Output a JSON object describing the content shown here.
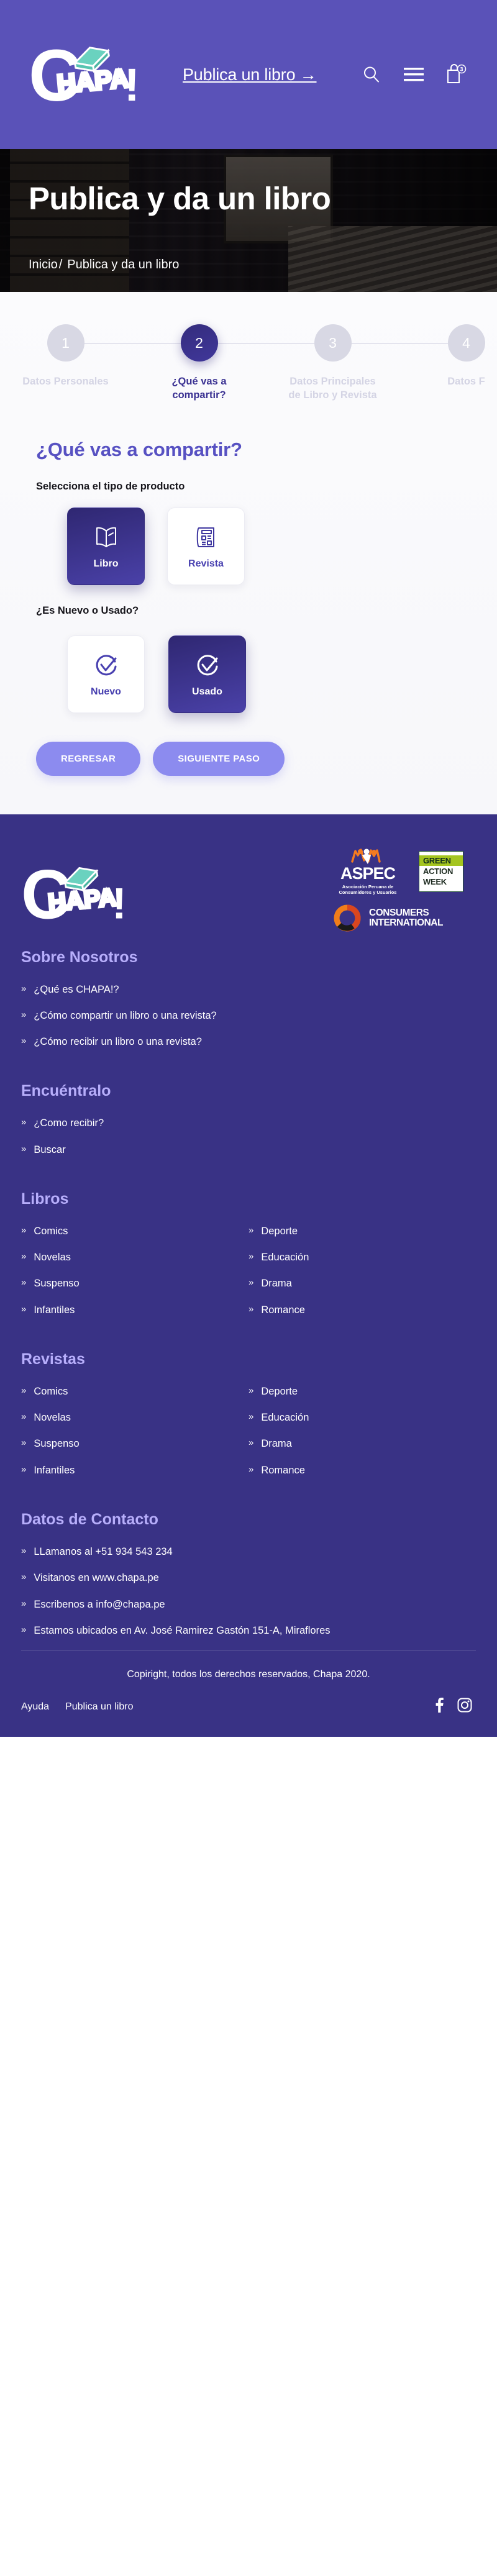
{
  "header": {
    "logo_text": "CHAPA!",
    "publish_link": "Publica un libro →",
    "icons": {
      "search": "search-icon",
      "menu": "menu-icon",
      "bag": "shopping-bag-icon"
    },
    "cart_count": "3",
    "bg_color": "#5a52b8"
  },
  "hero": {
    "title": "Publica y da un libro",
    "breadcrumb_home": "Inicio",
    "breadcrumb_sep": "/",
    "breadcrumb_current": "Publica y da un libro"
  },
  "stepper": {
    "steps": [
      {
        "number": "1",
        "label": "Datos Personales",
        "active": false
      },
      {
        "number": "2",
        "label": "¿Qué vas a compartir?",
        "active": true
      },
      {
        "number": "3",
        "label": "Datos Principales de Libro y Revista",
        "active": false
      },
      {
        "number": "4",
        "label": "Datos F",
        "active": false
      }
    ],
    "active_color": "#342c7d",
    "inactive_color": "#d8d8e4"
  },
  "form": {
    "section_title": "¿Qué vas a compartir?",
    "product_type_label": "Selecciona el tipo de producto",
    "product_types": [
      {
        "label": "Libro",
        "icon": "open-book-icon",
        "selected": true
      },
      {
        "label": "Revista",
        "icon": "magazine-icon",
        "selected": false
      }
    ],
    "condition_label": "¿Es Nuevo o Usado?",
    "conditions": [
      {
        "label": "Nuevo",
        "icon": "check-circle-icon",
        "selected": false
      },
      {
        "label": "Usado",
        "icon": "check-circle-icon",
        "selected": true
      }
    ],
    "back_button": "REGRESAR",
    "next_button": "SIGUIENTE PASO",
    "accent_color": "#5751c2",
    "button_color": "#8c8bef"
  },
  "footer": {
    "bg_color": "#393285",
    "heading_color": "#b7aefb",
    "logo_text": "CHAPA!",
    "partners": {
      "aspec_name": "ASPEC",
      "aspec_sub_line1": "Asociación Peruana de",
      "aspec_sub_line2": "Consumidores y Usuarios",
      "gaw_line1": "GREEN",
      "gaw_line2": "ACTION",
      "gaw_line3": "WEEK",
      "ci_line1": "CONSUMERS",
      "ci_line2": "INTERNATIONAL"
    },
    "sections": [
      {
        "title": "Sobre Nosotros",
        "items": [
          "¿Qué es CHAPA!?",
          "¿Cómo compartir un libro o una revista?",
          "¿Cómo recibir un libro o una revista?"
        ]
      },
      {
        "title": "Encuéntralo",
        "items": [
          "¿Como recibir?",
          "Buscar"
        ]
      }
    ],
    "libros": {
      "title": "Libros",
      "col1": [
        "Comics",
        "Novelas",
        "Suspenso",
        "Infantiles"
      ],
      "col2": [
        "Deporte",
        "Educación",
        "Drama",
        "Romance"
      ]
    },
    "revistas": {
      "title": "Revistas",
      "col1": [
        "Comics",
        "Novelas",
        "Suspenso",
        "Infantiles"
      ],
      "col2": [
        "Deporte",
        "Educación",
        "Drama",
        "Romance"
      ]
    },
    "contacto": {
      "title": "Datos de Contacto",
      "items": [
        "LLamanos al +51 934 543 234",
        "Visitanos en www.chapa.pe",
        "Escribenos a info@chapa.pe",
        "Estamos ubicados en Av. José Ramirez Gastón 151-A, Miraflores"
      ]
    },
    "copyright": "Copiright, todos los derechos reservados, Chapa 2020.",
    "bottom_links": [
      "Ayuda",
      "Publica un libro"
    ],
    "social": [
      "facebook-icon",
      "instagram-icon"
    ]
  }
}
